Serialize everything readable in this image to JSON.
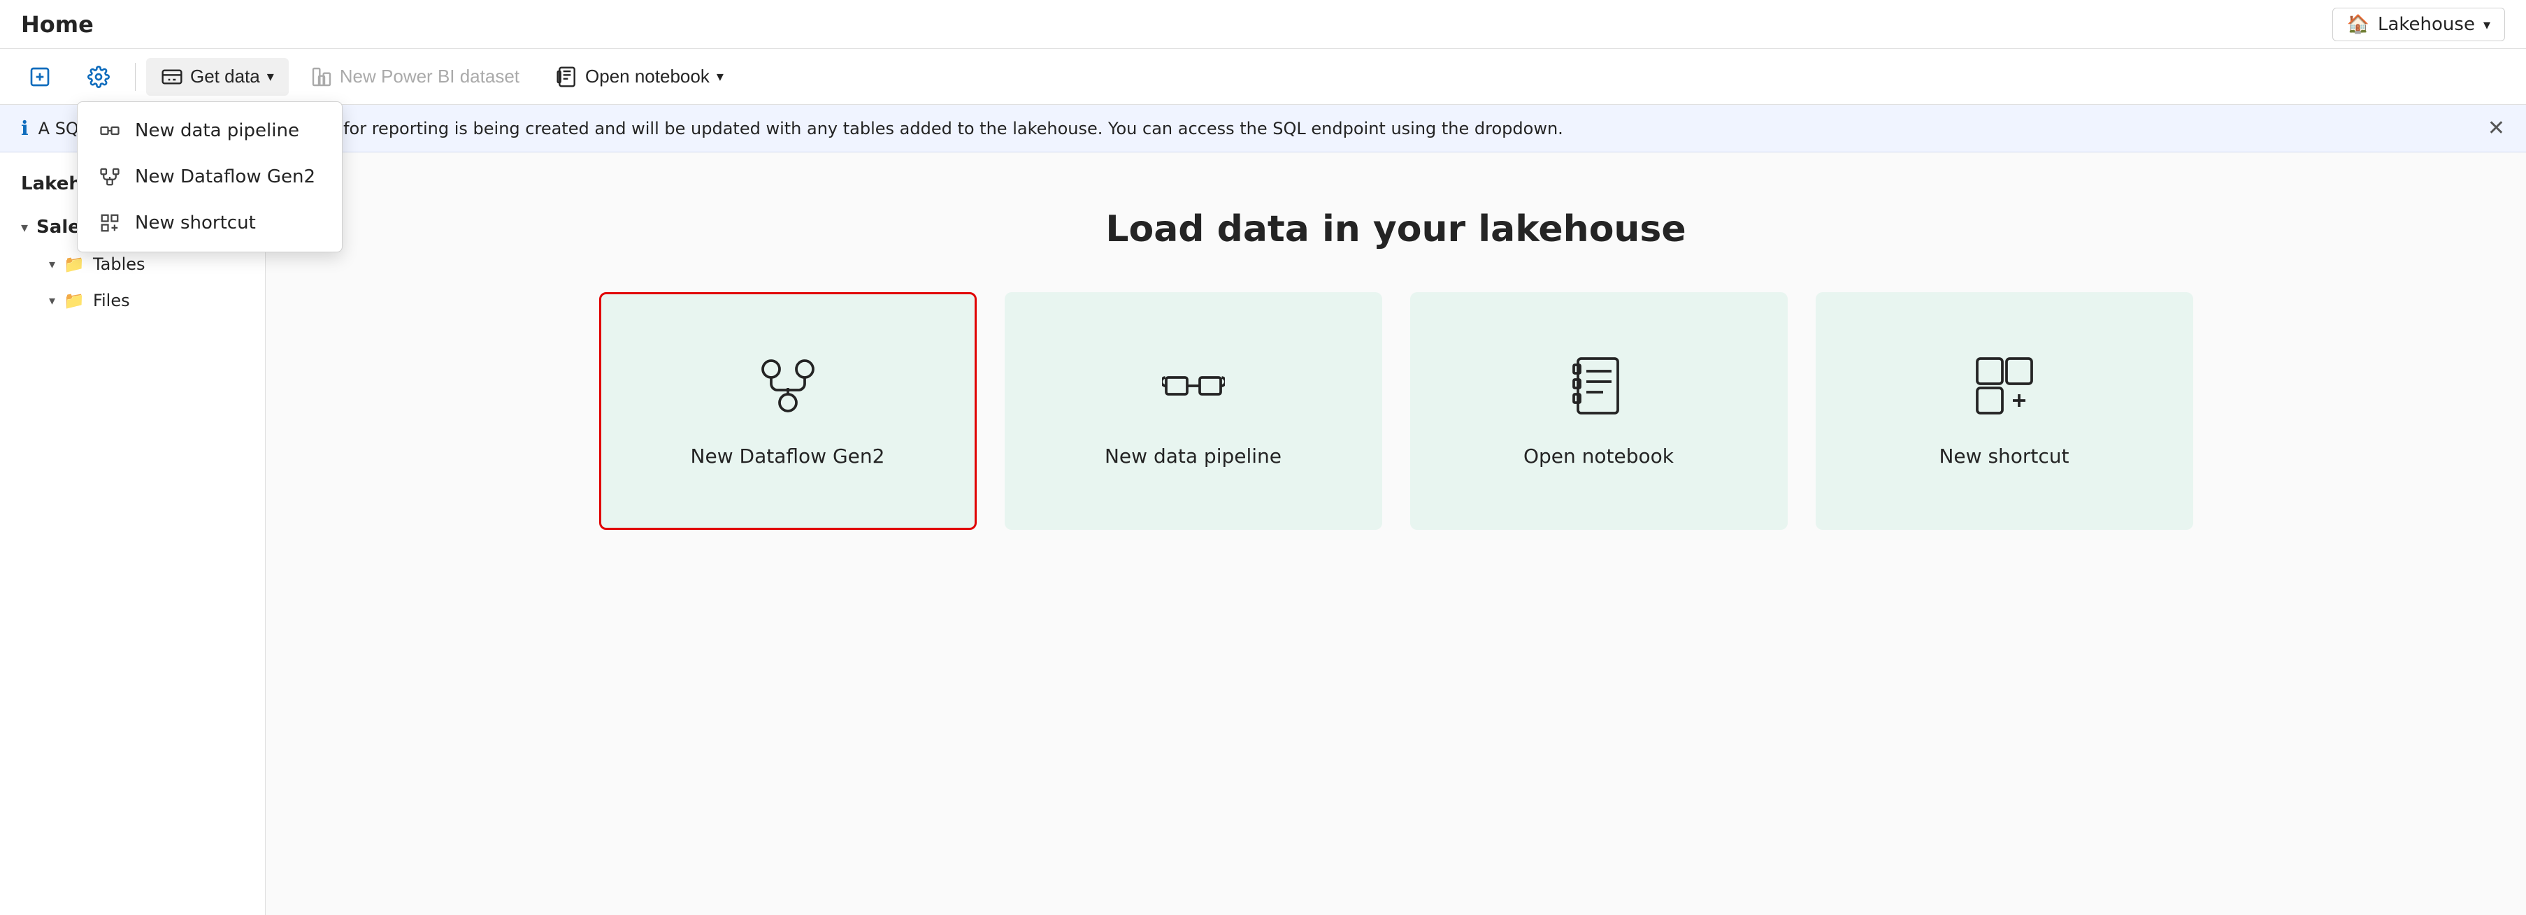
{
  "titlebar": {
    "title": "Home",
    "workspace_label": "Lakehouse",
    "workspace_icon": "🏠"
  },
  "toolbar": {
    "new_icon_label": "new",
    "settings_icon_label": "settings",
    "get_data_label": "Get data",
    "new_power_bi_label": "New Power BI dataset",
    "open_notebook_label": "Open notebook"
  },
  "dropdown": {
    "items": [
      {
        "label": "New data pipeline",
        "icon": "pipeline"
      },
      {
        "label": "New Dataflow Gen2",
        "icon": "dataflow"
      },
      {
        "label": "New shortcut",
        "icon": "shortcut"
      }
    ]
  },
  "notification": {
    "text": "A SQL endpoint and default dataset for reporting is being created and will be updated with any tables added to the lakehouse. You can access the SQL endpoint using the dropdown.",
    "prefix": "A SQL e..."
  },
  "sidebar": {
    "title": "Lakehouse",
    "lakehouse_name": "SalesLakehouse",
    "items": [
      {
        "label": "Tables",
        "type": "folder"
      },
      {
        "label": "Files",
        "type": "folder"
      }
    ]
  },
  "content": {
    "title": "Load data in your lakehouse",
    "cards": [
      {
        "label": "New Dataflow Gen2",
        "icon": "dataflow",
        "selected": true
      },
      {
        "label": "New data pipeline",
        "icon": "pipeline",
        "selected": false
      },
      {
        "label": "Open notebook",
        "icon": "notebook",
        "selected": false
      },
      {
        "label": "New shortcut",
        "icon": "shortcut",
        "selected": false
      }
    ]
  }
}
